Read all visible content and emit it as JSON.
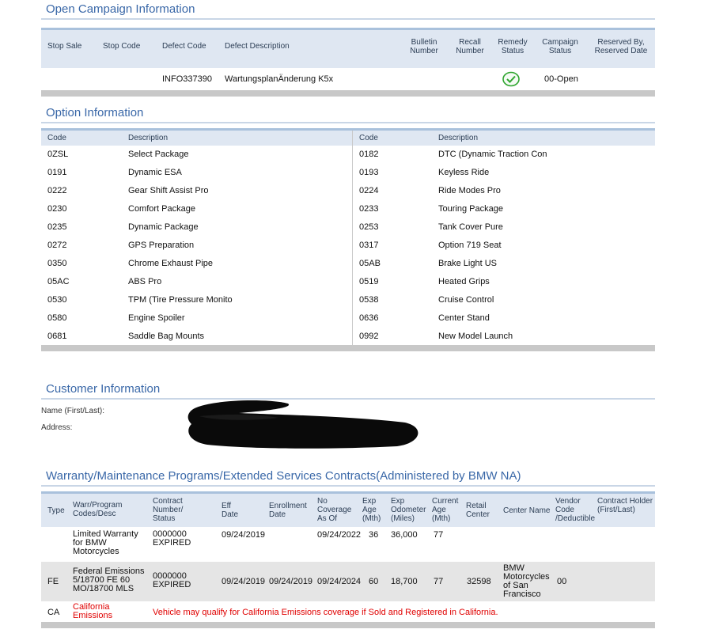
{
  "campaign": {
    "title": "Open Campaign Information",
    "headers": [
      "Stop Sale",
      "Stop Code",
      "Defect Code",
      "Defect Description",
      "Bulletin Number",
      "Recall Number",
      "Remedy Status",
      "Campaign Status",
      "Reserved By, Reserved Date"
    ],
    "row": {
      "stop_sale": "",
      "stop_code": "",
      "defect_code": "INFO337390",
      "defect_description": "WartungsplanÄnderung K5x",
      "bulletin_number": "",
      "recall_number": "",
      "remedy_status_icon": "check-circle-icon",
      "campaign_status": "00-Open",
      "reserved": ""
    }
  },
  "options": {
    "title": "Option Information",
    "headers": {
      "code": "Code",
      "description": "Description"
    },
    "left": [
      {
        "code": "0ZSL",
        "desc": "Select Package"
      },
      {
        "code": "0191",
        "desc": "Dynamic ESA"
      },
      {
        "code": "0222",
        "desc": "Gear Shift Assist Pro"
      },
      {
        "code": "0230",
        "desc": "Comfort Package"
      },
      {
        "code": "0235",
        "desc": "Dynamic Package"
      },
      {
        "code": "0272",
        "desc": "GPS Preparation"
      },
      {
        "code": "0350",
        "desc": "Chrome Exhaust Pipe"
      },
      {
        "code": "05AC",
        "desc": "ABS Pro"
      },
      {
        "code": "0530",
        "desc": "TPM (Tire Pressure Monito"
      },
      {
        "code": "0580",
        "desc": "Engine Spoiler"
      },
      {
        "code": "0681",
        "desc": "Saddle Bag Mounts"
      }
    ],
    "right": [
      {
        "code": "0182",
        "desc": "DTC (Dynamic Traction Con"
      },
      {
        "code": "0193",
        "desc": "Keyless Ride"
      },
      {
        "code": "0224",
        "desc": "Ride Modes Pro"
      },
      {
        "code": "0233",
        "desc": "Touring Package"
      },
      {
        "code": "0253",
        "desc": "Tank Cover Pure"
      },
      {
        "code": "0317",
        "desc": "Option 719 Seat"
      },
      {
        "code": "05AB",
        "desc": "Brake Light US"
      },
      {
        "code": "0519",
        "desc": "Heated Grips"
      },
      {
        "code": "0538",
        "desc": "Cruise Control"
      },
      {
        "code": "0636",
        "desc": "Center Stand"
      },
      {
        "code": "0992",
        "desc": "New Model Launch"
      }
    ]
  },
  "customer": {
    "title": "Customer Information",
    "name_label": "Name (First/Last):",
    "address_label": "Address:"
  },
  "warranty": {
    "title": "Warranty/Maintenance Programs/Extended Services Contracts(Administered by BMW NA)",
    "headers": {
      "type": "Type",
      "program": "Warr/Program Codes/Desc",
      "contract": "Contract Number/ Status",
      "eff_date": "Eff Date",
      "enrollment": "Enrollment Date",
      "no_coverage": "No Coverage As Of",
      "exp_age": "Exp Age (Mth)",
      "exp_odometer": "Exp Odometer (Miles)",
      "current_age": "Current Age (Mth)",
      "retail_center": "Retail Center",
      "center_name": "Center Name",
      "vendor": "Vendor Code /Deductible",
      "holder": "Contract Holder (First/Last)"
    },
    "rows": [
      {
        "type": "",
        "program": "Limited Warranty for BMW Motorcycles",
        "contract": "0000000 EXPIRED",
        "eff_date": "09/24/2019",
        "enrollment": "",
        "no_coverage": "09/24/2022",
        "exp_age": "36",
        "exp_odometer": "36,000",
        "current_age": "77",
        "retail_center": "",
        "center_name": "",
        "vendor": "",
        "holder": ""
      },
      {
        "type": "FE",
        "program": "Federal Emissions 5/18700 FE 60 MO/18700 MLS",
        "contract": "0000000 EXPIRED",
        "eff_date": "09/24/2019",
        "enrollment": "09/24/2019",
        "no_coverage": "09/24/2024",
        "exp_age": "60",
        "exp_odometer": "18,700",
        "current_age": "77",
        "retail_center": "32598",
        "center_name": "BMW Motorcycles of San Francisco",
        "vendor": "00",
        "holder": ""
      }
    ],
    "ca_row": {
      "type": "CA",
      "program": "California Emissions",
      "message": "Vehicle may qualify for California Emissions coverage if Sold and Registered in California."
    }
  },
  "colors": {
    "section_title": "#3a68a8",
    "header_bg": "#dfe7f2",
    "alert_red": "#e00000",
    "remedy_green": "#2fa52f"
  }
}
